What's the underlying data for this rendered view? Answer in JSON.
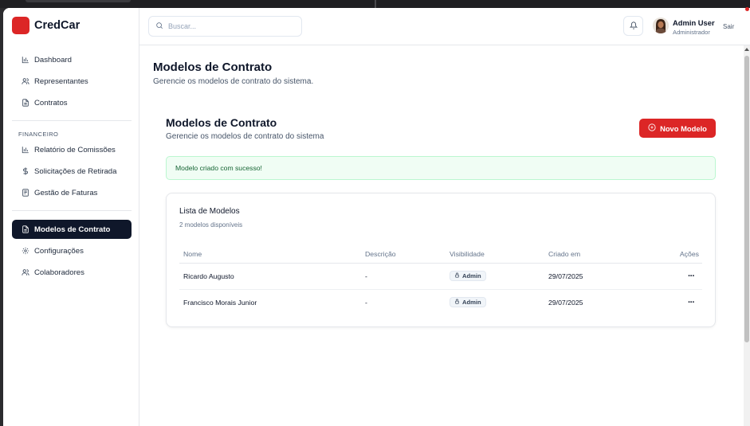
{
  "brand": {
    "name": "CredCar",
    "logo_color": "#dc2626"
  },
  "sidebar": {
    "main_items": [
      {
        "label": "Dashboard",
        "icon": "bar-chart-icon"
      },
      {
        "label": "Representantes",
        "icon": "users-icon"
      },
      {
        "label": "Contratos",
        "icon": "file-icon"
      }
    ],
    "section_label": "FINANCEIRO",
    "finance_items": [
      {
        "label": "Relatório de Comissões",
        "icon": "bar-chart-icon"
      },
      {
        "label": "Solicitações de Retirada",
        "icon": "dollar-icon"
      },
      {
        "label": "Gestão de Faturas",
        "icon": "receipt-icon"
      }
    ],
    "bottom_items": [
      {
        "label": "Modelos de Contrato",
        "icon": "file-icon",
        "active": true
      },
      {
        "label": "Configurações",
        "icon": "gear-icon"
      },
      {
        "label": "Colaboradores",
        "icon": "users-icon"
      }
    ]
  },
  "header": {
    "search_placeholder": "Buscar...",
    "user_name": "Admin User",
    "user_role": "Administrador",
    "logout_label": "Sair"
  },
  "page": {
    "title": "Modelos de Contrato",
    "subtitle": "Gerencie os modelos de contrato do sistema."
  },
  "card": {
    "title": "Modelos de Contrato",
    "subtitle": "Gerencie os modelos de contrato do sistema",
    "new_button_label": "Novo Modelo",
    "accent_color": "#dc2626"
  },
  "alert": {
    "message": "Modelo criado com sucesso!"
  },
  "list": {
    "title": "Lista de Modelos",
    "count_label": "2 modelos disponíveis",
    "columns": [
      "Nome",
      "Descrição",
      "Visibilidade",
      "Criado em",
      "Ações"
    ],
    "rows": [
      {
        "nome": "Ricardo Augusto",
        "descricao": "-",
        "visibilidade": "Admin",
        "criado_em": "29/07/2025",
        "acoes": "···"
      },
      {
        "nome": "Francisco Morais Junior",
        "descricao": "-",
        "visibilidade": "Admin",
        "criado_em": "29/07/2025",
        "acoes": "···"
      }
    ]
  }
}
